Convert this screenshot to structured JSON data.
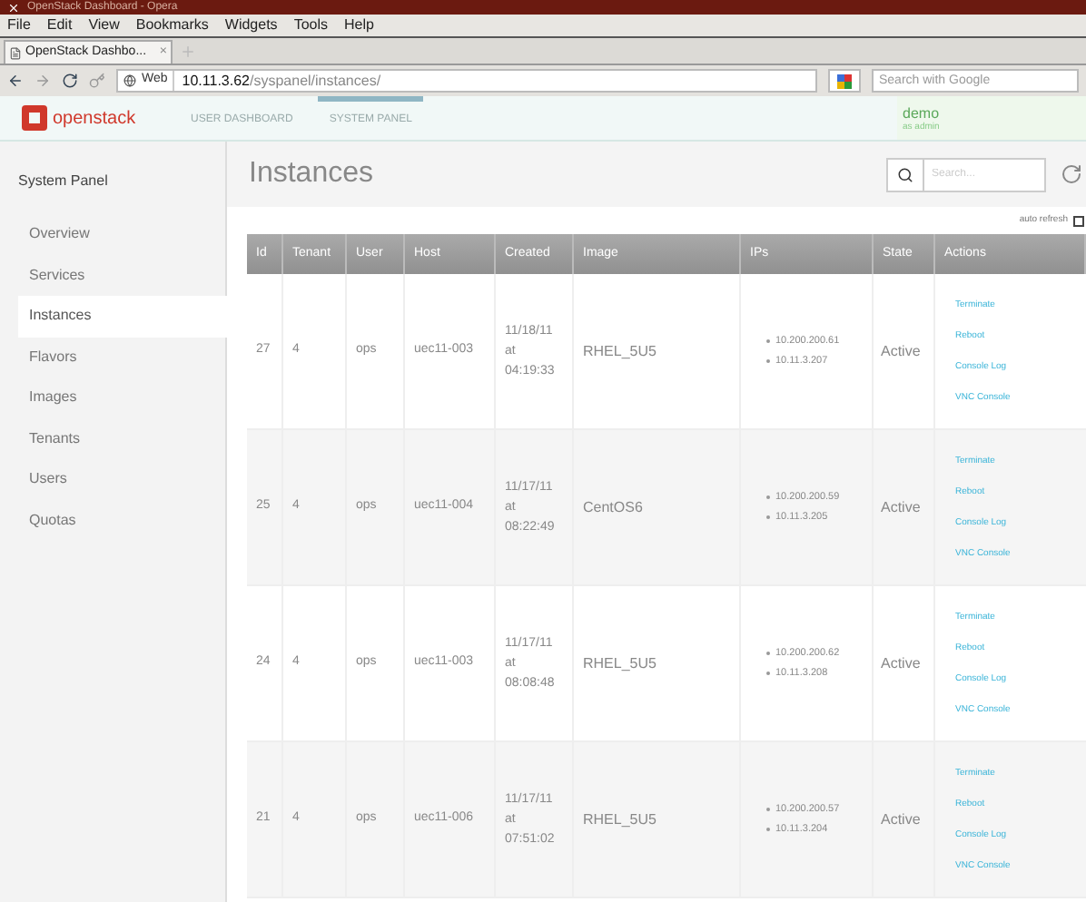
{
  "window": {
    "title": "OpenStack Dashboard - Opera"
  },
  "menu": [
    "File",
    "Edit",
    "View",
    "Bookmarks",
    "Widgets",
    "Tools",
    "Help"
  ],
  "browser_tabs": [
    {
      "label": "OpenStack Dashbo...",
      "close": "×",
      "selected": true
    }
  ],
  "address_bar": {
    "label": "Web",
    "host": "10.11.3.62",
    "path": "/syspanel/instances/"
  },
  "web_search": {
    "placeholder": "Search with Google"
  },
  "header": {
    "logo": "openstack",
    "nav": [
      {
        "label": "USER DASHBOARD",
        "selected": false
      },
      {
        "label": "SYSTEM PANEL",
        "selected": true
      }
    ],
    "user": {
      "name": "demo",
      "role": "as admin"
    }
  },
  "sidebar": {
    "title": "System Panel",
    "items": [
      {
        "label": "Overview",
        "selected": false
      },
      {
        "label": "Services",
        "selected": false
      },
      {
        "label": "Instances",
        "selected": true
      },
      {
        "label": "Flavors",
        "selected": false
      },
      {
        "label": "Images",
        "selected": false
      },
      {
        "label": "Tenants",
        "selected": false
      },
      {
        "label": "Users",
        "selected": false
      },
      {
        "label": "Quotas",
        "selected": false
      }
    ]
  },
  "page_title": "Instances",
  "search": {
    "placeholder": "Search..."
  },
  "auto_refresh": {
    "label": "auto refresh",
    "checked": false
  },
  "table": {
    "columns": [
      "Id",
      "Tenant",
      "User",
      "Host",
      "Created",
      "Image",
      "IPs",
      "State",
      "Actions"
    ],
    "rows": [
      {
        "id": "27",
        "tenant": "4",
        "user": "ops",
        "host": "uec11-003",
        "created": [
          "11/18/11",
          "at",
          "04:19:33"
        ],
        "image": "RHEL_5U5",
        "ips": [
          "10.200.200.61",
          "10.11.3.207"
        ],
        "state": "Active",
        "actions": [
          "Terminate",
          "Reboot",
          "Console Log",
          "VNC Console"
        ]
      },
      {
        "id": "25",
        "tenant": "4",
        "user": "ops",
        "host": "uec11-004",
        "created": [
          "11/17/11",
          "at",
          "08:22:49"
        ],
        "image": "CentOS6",
        "ips": [
          "10.200.200.59",
          "10.11.3.205"
        ],
        "state": "Active",
        "actions": [
          "Terminate",
          "Reboot",
          "Console Log",
          "VNC Console"
        ]
      },
      {
        "id": "24",
        "tenant": "4",
        "user": "ops",
        "host": "uec11-003",
        "created": [
          "11/17/11",
          "at",
          "08:08:48"
        ],
        "image": "RHEL_5U5",
        "ips": [
          "10.200.200.62",
          "10.11.3.208"
        ],
        "state": "Active",
        "actions": [
          "Terminate",
          "Reboot",
          "Console Log",
          "VNC Console"
        ]
      },
      {
        "id": "21",
        "tenant": "4",
        "user": "ops",
        "host": "uec11-006",
        "created": [
          "11/17/11",
          "at",
          "07:51:02"
        ],
        "image": "RHEL_5U5",
        "ips": [
          "10.200.200.57",
          "10.11.3.204"
        ],
        "state": "Active",
        "actions": [
          "Terminate",
          "Reboot",
          "Console Log",
          "VNC Console"
        ]
      }
    ]
  }
}
